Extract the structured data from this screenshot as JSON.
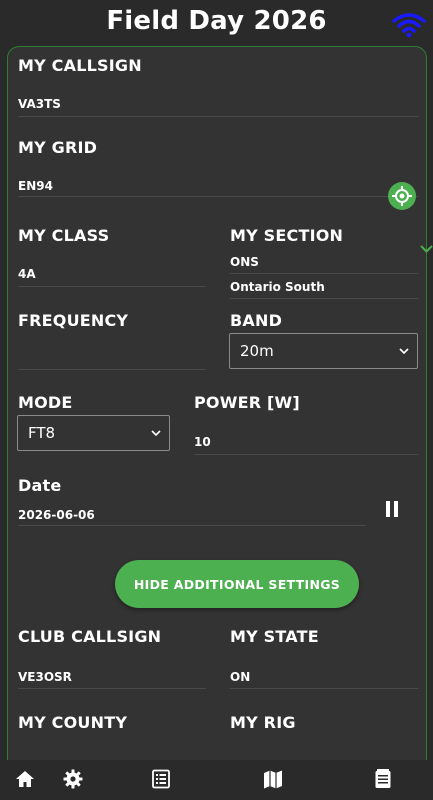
{
  "header": {
    "title": "Field Day 2026"
  },
  "form": {
    "my_callsign": {
      "label": "MY CALLSIGN",
      "value": "VA3TS"
    },
    "my_grid": {
      "label": "MY GRID",
      "value": "EN94"
    },
    "my_class": {
      "label": "MY CLASS",
      "value": "4A"
    },
    "my_section": {
      "label": "MY SECTION",
      "value": "ONS",
      "name": "Ontario South"
    },
    "frequency": {
      "label": "FREQUENCY",
      "value": ""
    },
    "band": {
      "label": "BAND",
      "value": "20m"
    },
    "mode": {
      "label": "MODE",
      "value": "FT8"
    },
    "power": {
      "label": "POWER [W]",
      "value": "10"
    },
    "date": {
      "label": "Date",
      "value": "2026-06-06"
    },
    "hide_button": "HIDE ADDITIONAL SETTINGS",
    "club_callsign": {
      "label": "CLUB CALLSIGN",
      "value": "VE3OSR"
    },
    "my_state": {
      "label": "MY STATE",
      "value": "ON"
    },
    "my_county": {
      "label": "MY COUNTY"
    },
    "my_rig": {
      "label": "MY RIG"
    }
  },
  "icons": {
    "wifi": "wifi-icon",
    "gps": "crosshair-location-icon",
    "pause": "pause-icon",
    "nav": [
      "home-icon",
      "gear-icon",
      "list-icon",
      "map-icon",
      "log-icon"
    ]
  },
  "colors": {
    "accent": "#4caf50",
    "wifi": "#1a1aff",
    "background": "#2a2a2a",
    "card": "#333333"
  }
}
